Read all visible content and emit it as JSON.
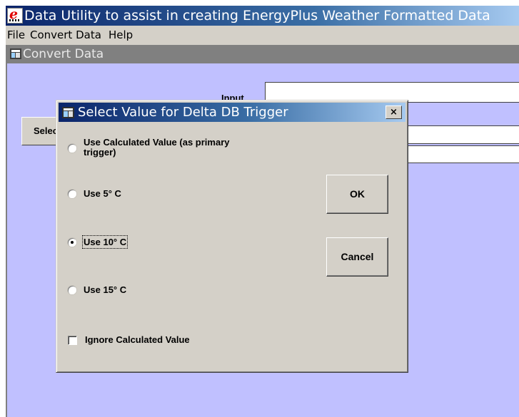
{
  "app": {
    "title": "Data Utility to assist in creating EnergyPlus Weather Formatted Data",
    "menu": [
      "File",
      "Convert Data",
      "Help"
    ]
  },
  "child_window": {
    "title": "Convert Data",
    "input_label": "Input",
    "select_button": "Select"
  },
  "dialog": {
    "title": "Select Value for Delta DB Trigger",
    "close_label": "×",
    "options": [
      {
        "label_line1": "Use Calculated Value (as primary",
        "label_line2": "trigger)",
        "selected": false
      },
      {
        "label": "Use 5° C",
        "selected": false
      },
      {
        "label": "Use 10° C",
        "selected": true
      },
      {
        "label": "Use 15° C",
        "selected": false
      }
    ],
    "checkbox": {
      "label": "Ignore Calculated Value",
      "checked": false
    },
    "ok_label": "OK",
    "cancel_label": "Cancel"
  },
  "colors": {
    "titlebar_active": "#0a246a",
    "mdi_background": "#c0c0ff",
    "face": "#d4d0c8"
  }
}
